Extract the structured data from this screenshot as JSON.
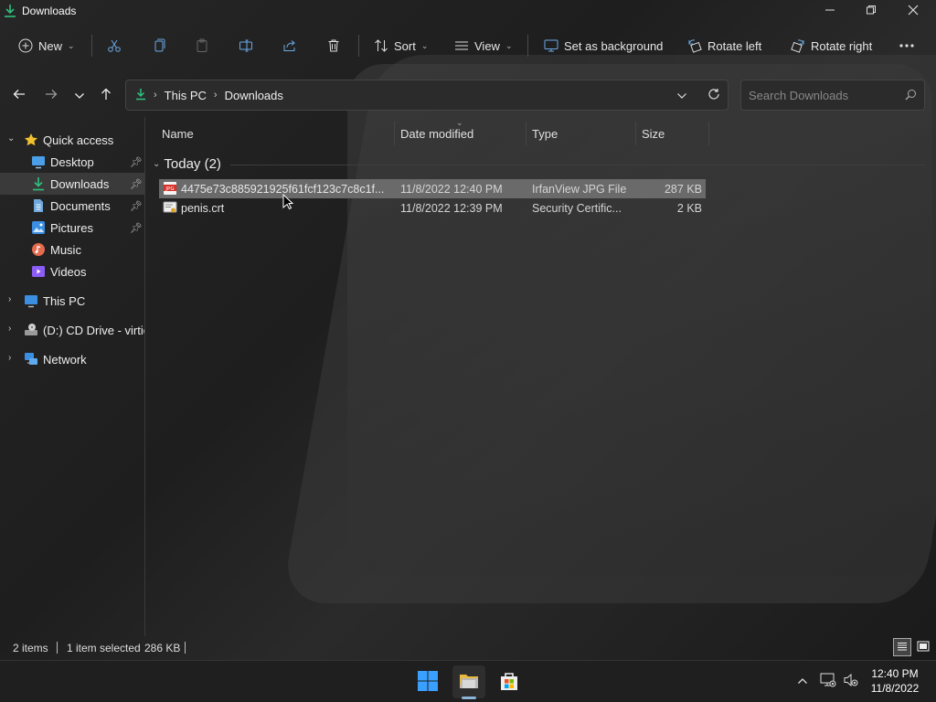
{
  "window": {
    "title": "Downloads"
  },
  "toolbar": {
    "new_label": "New",
    "sort_label": "Sort",
    "view_label": "View",
    "set_background_label": "Set as background",
    "rotate_left_label": "Rotate left",
    "rotate_right_label": "Rotate right"
  },
  "address": {
    "crumbs": [
      "This PC",
      "Downloads"
    ]
  },
  "search": {
    "placeholder": "Search Downloads"
  },
  "sidebar": {
    "quick_access": "Quick access",
    "items": [
      {
        "label": "Desktop",
        "icon": "desktop-icon",
        "pinned": true
      },
      {
        "label": "Downloads",
        "icon": "downloads-icon",
        "pinned": true
      },
      {
        "label": "Documents",
        "icon": "documents-icon",
        "pinned": true
      },
      {
        "label": "Pictures",
        "icon": "pictures-icon",
        "pinned": true
      },
      {
        "label": "Music",
        "icon": "music-icon",
        "pinned": false
      },
      {
        "label": "Videos",
        "icon": "videos-icon",
        "pinned": false
      }
    ],
    "this_pc": "This PC",
    "cd_drive": "(D:) CD Drive - virtio",
    "network": "Network"
  },
  "columns": {
    "name": "Name",
    "date": "Date modified",
    "type": "Type",
    "size": "Size"
  },
  "group": {
    "label": "Today (2)"
  },
  "files": [
    {
      "name": "4475e73c885921925f61fcf123c7c8c1f...",
      "date": "11/8/2022 12:40 PM",
      "type": "IrfanView JPG File",
      "size": "287 KB",
      "icon": "jpg-file-icon"
    },
    {
      "name": "penis.crt",
      "date": "11/8/2022 12:39 PM",
      "type": "Security Certific...",
      "size": "2 KB",
      "icon": "certificate-file-icon"
    }
  ],
  "status": {
    "items": "2 items",
    "selected": "1 item selected",
    "size": "286 KB"
  },
  "clock": {
    "time": "12:40 PM",
    "date": "11/8/2022"
  },
  "colors": {
    "accent": "#3aa0ff",
    "download_green": "#2ec27e",
    "selected_row": "#6a6a6a"
  }
}
